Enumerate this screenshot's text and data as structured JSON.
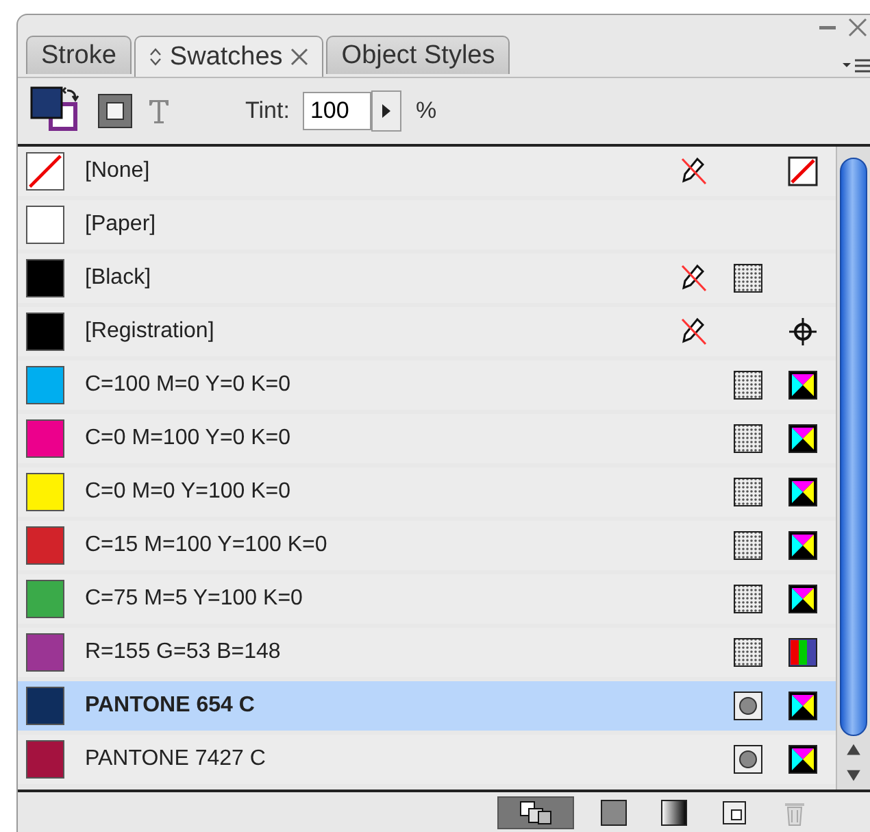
{
  "tabs": [
    {
      "label": "Stroke",
      "selected": false
    },
    {
      "label": "Swatches",
      "selected": true
    },
    {
      "label": "Object Styles",
      "selected": false
    }
  ],
  "toolbar": {
    "tint_label": "Tint:",
    "tint_value": "100",
    "tint_unit": "%"
  },
  "swatches": [
    {
      "name": "[None]",
      "kind": "none",
      "color": "#ffffff",
      "locked": true,
      "mode_icon": {
        "kind": "none"
      },
      "selected": false
    },
    {
      "name": "[Paper]",
      "kind": "solid",
      "color": "#ffffff",
      "locked": false,
      "selected": false
    },
    {
      "name": "[Black]",
      "kind": "solid",
      "color": "#000000",
      "locked": true,
      "type_icon": {
        "kind": "process"
      },
      "selected": false
    },
    {
      "name": "[Registration]",
      "kind": "solid",
      "color": "#000000",
      "locked": true,
      "mode_icon": {
        "kind": "registration"
      },
      "selected": false
    },
    {
      "name": "C=100 M=0 Y=0 K=0",
      "kind": "solid",
      "color": "#00aeef",
      "locked": false,
      "type_icon": {
        "kind": "process"
      },
      "mode_icon": {
        "kind": "cmyk"
      },
      "selected": false
    },
    {
      "name": "C=0 M=100 Y=0 K=0",
      "kind": "solid",
      "color": "#ec008c",
      "locked": false,
      "type_icon": {
        "kind": "process"
      },
      "mode_icon": {
        "kind": "cmyk"
      },
      "selected": false
    },
    {
      "name": "C=0 M=0 Y=100 K=0",
      "kind": "solid",
      "color": "#fff200",
      "locked": false,
      "type_icon": {
        "kind": "process"
      },
      "mode_icon": {
        "kind": "cmyk"
      },
      "selected": false
    },
    {
      "name": "C=15 M=100 Y=100 K=0",
      "kind": "solid",
      "color": "#d2232a",
      "locked": false,
      "type_icon": {
        "kind": "process"
      },
      "mode_icon": {
        "kind": "cmyk"
      },
      "selected": false
    },
    {
      "name": "C=75 M=5 Y=100 K=0",
      "kind": "solid",
      "color": "#3aaa49",
      "locked": false,
      "type_icon": {
        "kind": "process"
      },
      "mode_icon": {
        "kind": "cmyk"
      },
      "selected": false
    },
    {
      "name": "R=155 G=53 B=148",
      "kind": "solid",
      "color": "#9b3594",
      "locked": false,
      "type_icon": {
        "kind": "process"
      },
      "mode_icon": {
        "kind": "rgb"
      },
      "selected": false
    },
    {
      "name": "PANTONE 654 C",
      "kind": "solid",
      "color": "#0f2e5e",
      "locked": false,
      "type_icon": {
        "kind": "spot"
      },
      "mode_icon": {
        "kind": "cmyk"
      },
      "selected": true
    },
    {
      "name": "PANTONE 7427 C",
      "kind": "solid",
      "color": "#a4123f",
      "locked": false,
      "type_icon": {
        "kind": "spot"
      },
      "mode_icon": {
        "kind": "cmyk"
      },
      "selected": false
    }
  ],
  "bottom_buttons": [
    {
      "kind": "show-all",
      "selected": true
    },
    {
      "kind": "show-color",
      "selected": false
    },
    {
      "kind": "show-gradient",
      "selected": false
    },
    {
      "kind": "new",
      "selected": false
    },
    {
      "kind": "delete",
      "selected": false
    }
  ]
}
